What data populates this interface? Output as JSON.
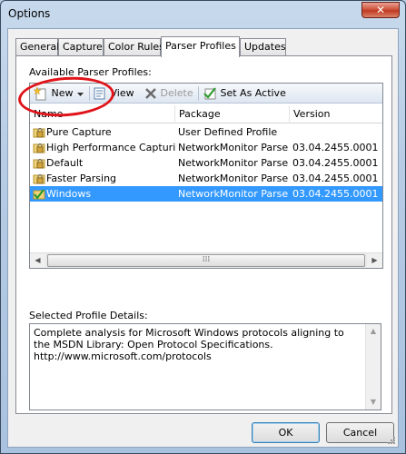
{
  "window": {
    "title": "Options",
    "close_label": "✕"
  },
  "tabs": [
    {
      "label": "General"
    },
    {
      "label": "Capture"
    },
    {
      "label": "Color Rules"
    },
    {
      "label": "Parser Profiles"
    },
    {
      "label": "Updates"
    }
  ],
  "available_label": "Available Parser Profiles:",
  "toolbar": {
    "new_label": "New",
    "view_label": "View",
    "delete_label": "Delete",
    "set_active_label": "Set As Active"
  },
  "columns": [
    "Name",
    "Package",
    "Version"
  ],
  "profiles": [
    {
      "name": "Pure Capture",
      "package": "User Defined Profile",
      "version": "",
      "icon": "lock-folder-icon"
    },
    {
      "name": "High Performance Capturing",
      "package": "NetworkMonitor Parsers",
      "version": "03.04.2455.0001",
      "icon": "lock-folder-icon"
    },
    {
      "name": "Default",
      "package": "NetworkMonitor Parsers",
      "version": "03.04.2455.0001",
      "icon": "lock-folder-icon"
    },
    {
      "name": "Faster Parsing",
      "package": "NetworkMonitor Parsers",
      "version": "03.04.2455.0001",
      "icon": "lock-folder-icon"
    },
    {
      "name": "Windows",
      "package": "NetworkMonitor Parsers",
      "version": "03.04.2455.0001",
      "icon": "active-check-folder-icon",
      "selected": true
    }
  ],
  "details_label": "Selected Profile Details:",
  "details_text": "Complete analysis for Microsoft Windows protocols aligning to the MSDN Library: Open Protocol Specifications.\nhttp://www.microsoft.com/protocols",
  "buttons": {
    "ok": "OK",
    "cancel": "Cancel"
  },
  "colors": {
    "selection": "#3399ff",
    "annotation": "#e0141a"
  }
}
